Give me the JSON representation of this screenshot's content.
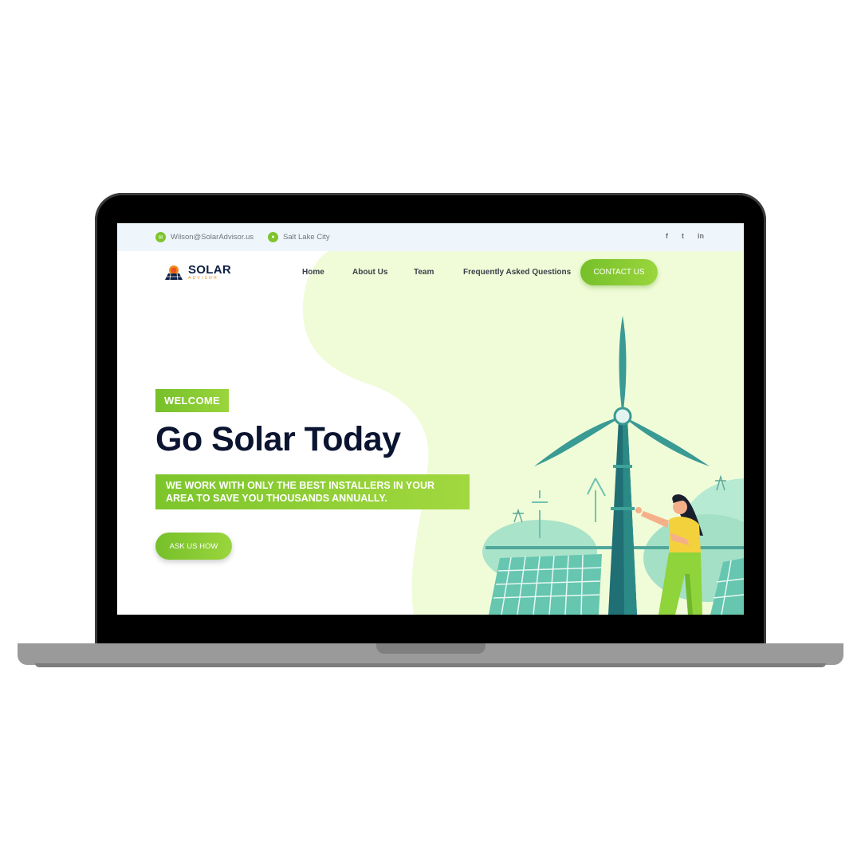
{
  "topbar": {
    "email": "Wilson@SolarAdvisor.us",
    "email_icon": "envelope-icon",
    "location": "Salt Lake City",
    "location_icon": "location-pin-icon",
    "social": [
      {
        "icon": "facebook-icon",
        "glyph": "f"
      },
      {
        "icon": "twitter-icon",
        "glyph": "t"
      },
      {
        "icon": "linkedin-icon",
        "glyph": "in"
      }
    ]
  },
  "header": {
    "logo_main": "SOLAR",
    "logo_sub": "ADVISOR",
    "nav": [
      "Home",
      "About Us",
      "Team",
      "Frequently Asked Questions"
    ],
    "contact_label": "CONTACT US"
  },
  "hero": {
    "badge": "WELCOME",
    "title": "Go Solar Today",
    "subtitle": "WE WORK WITH ONLY THE BEST INSTALLERS IN YOUR AREA TO SAVE YOU THOUSANDS ANNUALLY.",
    "cta_label": "ASK US HOW"
  },
  "colors": {
    "accent": "#7ec42c",
    "navy": "#0b1430",
    "blob": "#f0fcd8",
    "teal": "#2f8f8a"
  }
}
